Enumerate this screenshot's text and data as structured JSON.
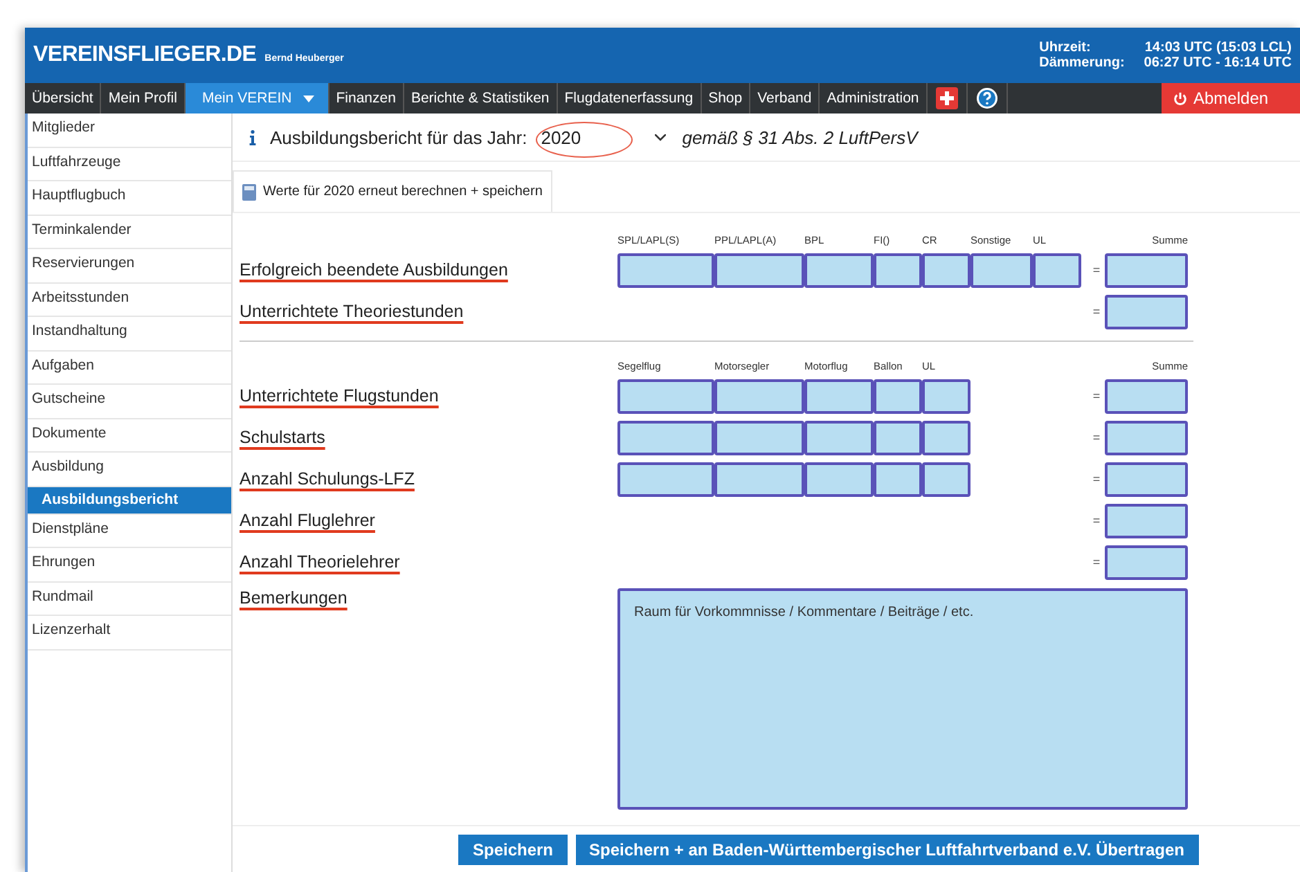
{
  "header": {
    "logo": "VEREINSFLIEGER.DE",
    "user": "Bernd Heuberger",
    "clock": [
      {
        "label": "Uhrzeit:",
        "value": "14:03 UTC (15:03 LCL)"
      },
      {
        "label": "Dämmerung:",
        "value": "06:27 UTC - 16:14 UTC"
      }
    ]
  },
  "nav": {
    "items": [
      {
        "label": "Übersicht",
        "selected": false,
        "dropdown": false
      },
      {
        "label": "Mein Profil",
        "selected": false,
        "dropdown": false
      },
      {
        "label": "Mein VEREIN",
        "selected": true,
        "dropdown": true
      },
      {
        "label": "Finanzen",
        "selected": false,
        "dropdown": false
      },
      {
        "label": "Berichte & Statistiken",
        "selected": false,
        "dropdown": false
      },
      {
        "label": "Flugdatenerfassung",
        "selected": false,
        "dropdown": false
      },
      {
        "label": "Shop",
        "selected": false,
        "dropdown": false
      },
      {
        "label": "Verband",
        "selected": false,
        "dropdown": false
      },
      {
        "label": "Administration",
        "selected": false,
        "dropdown": false
      }
    ],
    "logout": "Abmelden"
  },
  "sidebar": {
    "items": [
      {
        "label": "Mitglieder",
        "selected": false
      },
      {
        "label": "Luftfahrzeuge",
        "selected": false
      },
      {
        "label": "Hauptflugbuch",
        "selected": false
      },
      {
        "label": "Terminkalender",
        "selected": false
      },
      {
        "label": "Reservierungen",
        "selected": false
      },
      {
        "label": "Arbeitsstunden",
        "selected": false
      },
      {
        "label": "Instandhaltung",
        "selected": false
      },
      {
        "label": "Aufgaben",
        "selected": false
      },
      {
        "label": "Gutscheine",
        "selected": false
      },
      {
        "label": "Dokumente",
        "selected": false
      },
      {
        "label": "Ausbildung",
        "selected": false,
        "children": [
          {
            "label": "Ausbildungsbericht",
            "selected": true
          }
        ]
      },
      {
        "label": "Dienstpläne",
        "selected": false
      },
      {
        "label": "Ehrungen",
        "selected": false
      },
      {
        "label": "Rundmail",
        "selected": false
      },
      {
        "label": "Lizenzerhalt",
        "selected": false
      }
    ]
  },
  "report": {
    "title": "Ausbildungsbericht für das Jahr:",
    "year": "2020",
    "legal": "gemäß § 31 Abs. 2 LuftPersV",
    "recalc_button": "Werte für 2020 erneut berechnen + speichern",
    "sections": [
      {
        "columns": [
          "SPL/LAPL(S)",
          "PPL/LAPL(A)",
          "BPL",
          "FI()",
          "CR",
          "Sonstige",
          "UL"
        ],
        "sum_label": "Summe",
        "rows": [
          {
            "label": "Erfolgreich beendete Ausbildungen",
            "kind": "full",
            "equals": "="
          },
          {
            "label": "Unterrichtete Theoriestunden",
            "kind": "sum",
            "equals": "="
          }
        ]
      },
      {
        "columns": [
          "Segelflug",
          "Motorsegler",
          "Motorflug",
          "Ballon",
          "UL"
        ],
        "sum_label": "Summe",
        "rows": [
          {
            "label": "Unterrichtete Flugstunden",
            "kind": "full",
            "equals": "="
          },
          {
            "label": "Schulstarts",
            "kind": "full",
            "equals": "="
          },
          {
            "label": "Anzahl Schulungs-LFZ",
            "kind": "full",
            "equals": "="
          },
          {
            "label": "Anzahl Fluglehrer",
            "kind": "sum",
            "equals": "="
          },
          {
            "label": "Anzahl Theorielehrer",
            "kind": "sum",
            "equals": "="
          }
        ]
      }
    ],
    "remarks": {
      "label": "Bemerkungen",
      "placeholder": "Raum für Vorkommnisse / Kommentare / Beiträge / etc."
    },
    "buttons": [
      "Speichern",
      "Speichern + an Baden-Württembergischer Luftfahrtverband e.V. Übertragen"
    ]
  }
}
